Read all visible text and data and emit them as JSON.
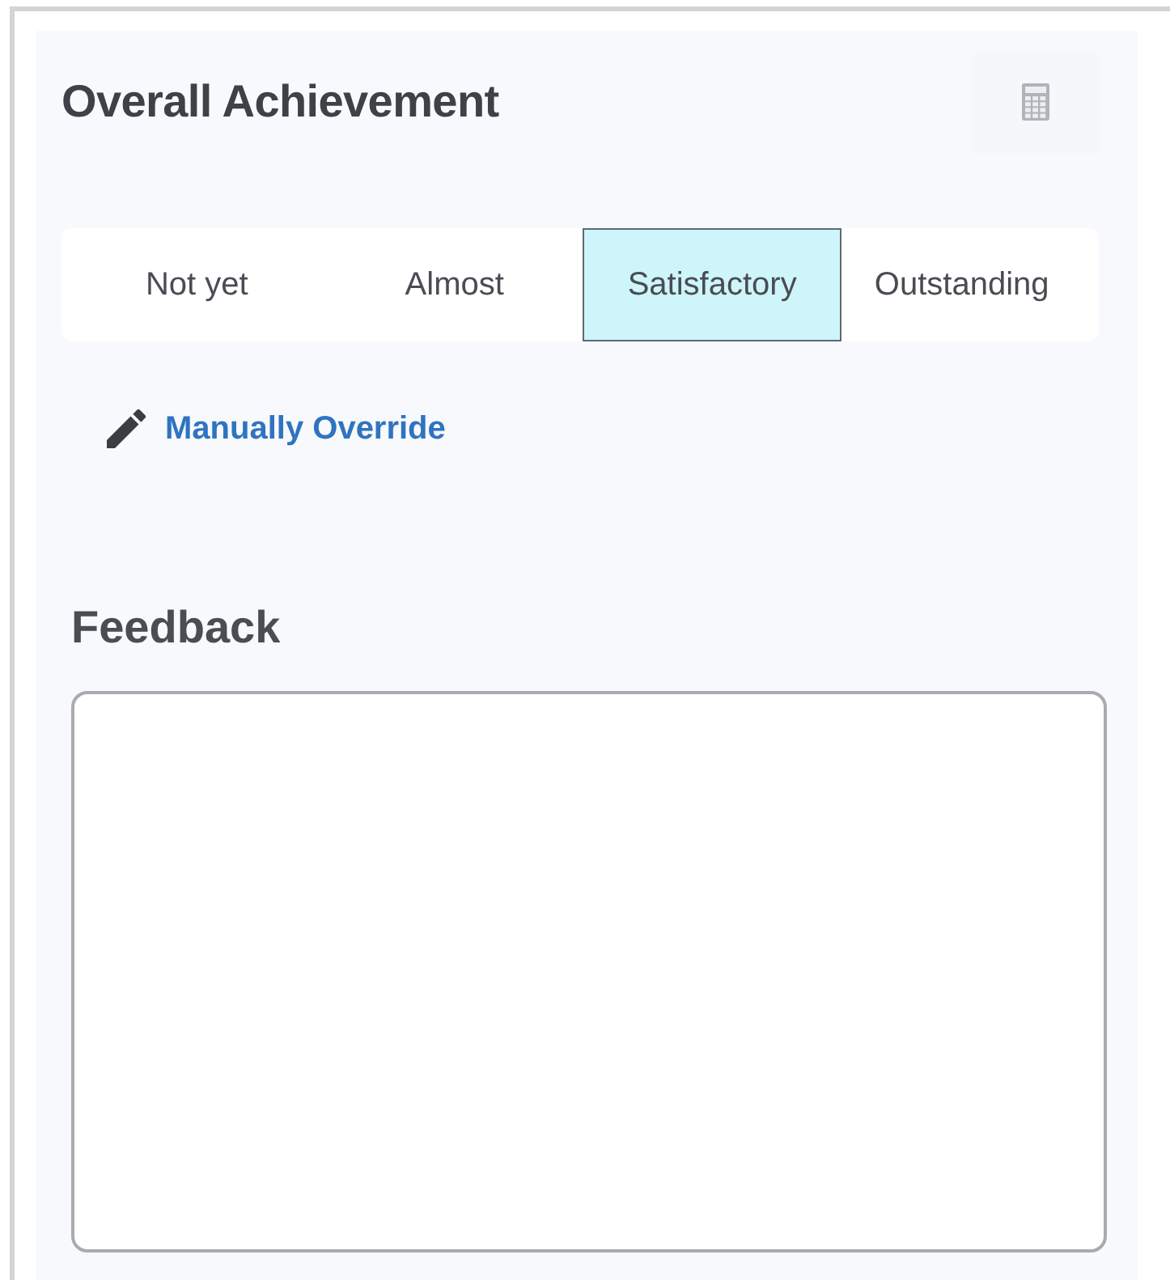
{
  "title": "Overall Achievement",
  "levels": [
    {
      "label": "Not yet",
      "selected": false
    },
    {
      "label": "Almost",
      "selected": false
    },
    {
      "label": "Satisfactory",
      "selected": true
    },
    {
      "label": "Outstanding",
      "selected": false
    }
  ],
  "override_link": "Manually Override",
  "feedback": {
    "label": "Feedback"
  }
}
